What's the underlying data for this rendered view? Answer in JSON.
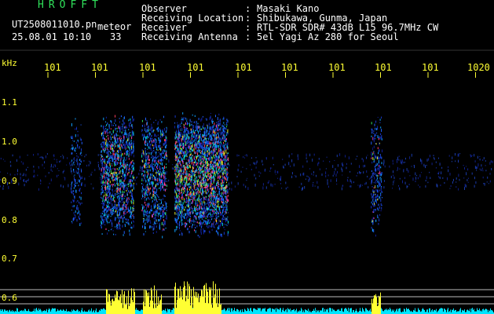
{
  "header": {
    "brand": "HROFFT",
    "file_name": "UT2508011010.pn",
    "mode_tag": "meteor",
    "timestamp": "25.08.01 10:10",
    "count": "33",
    "info": [
      {
        "label": "Observer",
        "value": "Masaki Kano"
      },
      {
        "label": "Receiving Location",
        "value": "Shibukawa, Gunma, Japan"
      },
      {
        "label": "Receiver",
        "value": "RTL-SDR SDR# 43dB L15 96.7MHz CW"
      },
      {
        "label": "Receiving Antenna",
        "value": "5el Yagi Az 280 for Seoul"
      }
    ],
    "separator": ":"
  },
  "axes": {
    "y_unit": "kHz",
    "x_ticks": [
      "101",
      "101",
      "101",
      "101",
      "101",
      "101",
      "101",
      "101",
      "101",
      "1020"
    ],
    "y_ticks": [
      "1.1",
      "1.0",
      "0.9",
      "0.8",
      "0.7",
      "0.6"
    ]
  },
  "colors": {
    "label_green": "#2fe05a",
    "text_white": "#ffffff",
    "level_yellow": "#ffff33",
    "noise_cyan": "#00e5ff",
    "background": "#000000"
  }
}
